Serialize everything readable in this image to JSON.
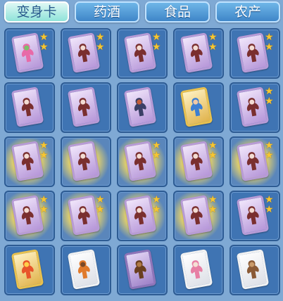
{
  "tabs": [
    {
      "label": "变身卡",
      "active": true
    },
    {
      "label": "药酒",
      "active": false
    },
    {
      "label": "食品",
      "active": false
    },
    {
      "label": "农产",
      "active": false
    }
  ],
  "grid": {
    "rows": 5,
    "cols": 5,
    "items": [
      {
        "card": "purple",
        "art": "pink-flower-creature",
        "stars": 2,
        "glow": false
      },
      {
        "card": "purple",
        "art": "winged-girl",
        "stars": 2,
        "glow": false
      },
      {
        "card": "purple",
        "art": "winged-girl",
        "stars": 2,
        "glow": false
      },
      {
        "card": "purple",
        "art": "winged-girl",
        "stars": 2,
        "glow": false
      },
      {
        "card": "purple",
        "art": "winged-girl",
        "stars": 2,
        "glow": false
      },
      {
        "card": "purple",
        "art": "winged-girl",
        "stars": 0,
        "glow": false
      },
      {
        "card": "purple",
        "art": "winged-girl",
        "stars": 0,
        "glow": false
      },
      {
        "card": "purple",
        "art": "armored-warrior",
        "stars": 0,
        "glow": false
      },
      {
        "card": "gold",
        "art": "blue-haired-hero",
        "stars": 0,
        "glow": false
      },
      {
        "card": "purple",
        "art": "winged-girl",
        "stars": 2,
        "glow": false
      },
      {
        "card": "purple",
        "art": "winged-girl",
        "stars": 2,
        "glow": true
      },
      {
        "card": "purple",
        "art": "winged-girl",
        "stars": 0,
        "glow": true
      },
      {
        "card": "purple",
        "art": "winged-girl",
        "stars": 2,
        "glow": true
      },
      {
        "card": "purple",
        "art": "winged-girl",
        "stars": 2,
        "glow": true
      },
      {
        "card": "purple",
        "art": "winged-girl",
        "stars": 2,
        "glow": true
      },
      {
        "card": "purple",
        "art": "winged-girl",
        "stars": 2,
        "glow": true
      },
      {
        "card": "purple",
        "art": "winged-girl",
        "stars": 2,
        "glow": true
      },
      {
        "card": "purple",
        "art": "winged-girl",
        "stars": 2,
        "glow": true
      },
      {
        "card": "purple",
        "art": "winged-girl",
        "stars": 2,
        "glow": true
      },
      {
        "card": "purple",
        "art": "winged-girl",
        "stars": 2,
        "glow": false
      },
      {
        "card": "gold",
        "art": "fire-fox",
        "stars": 0,
        "glow": false
      },
      {
        "card": "white",
        "art": "orange-monkey",
        "stars": 0,
        "glow": false
      },
      {
        "card": "purple-dark",
        "art": "brown-ape",
        "stars": 0,
        "glow": false
      },
      {
        "card": "white",
        "art": "pink-haired-girl",
        "stars": 0,
        "glow": false
      },
      {
        "card": "white",
        "art": "brown-bear",
        "stars": 0,
        "glow": false
      }
    ]
  },
  "art_colors": {
    "winged-girl": [
      "#7a2f2f",
      "#f3dcd3"
    ],
    "pink-flower-creature": [
      "#e86aa8",
      "#7cc06a"
    ],
    "armored-warrior": [
      "#3b3f66",
      "#c25c3a"
    ],
    "blue-haired-hero": [
      "#3d7fd1",
      "#f0c9a5"
    ],
    "fire-fox": [
      "#e8542a",
      "#ffcf4a"
    ],
    "orange-monkey": [
      "#e07a2c",
      "#7a4a2a"
    ],
    "brown-ape": [
      "#6a3f1f",
      "#b07a45"
    ],
    "pink-haired-girl": [
      "#e77fa4",
      "#f5e0d4"
    ],
    "brown-bear": [
      "#8a5a36",
      "#c99a6a"
    ]
  },
  "star_glyph": "★",
  "accent": {
    "tab_active": "#8fe3d9",
    "tab": "#3f86c8",
    "star": "#f6c632"
  }
}
